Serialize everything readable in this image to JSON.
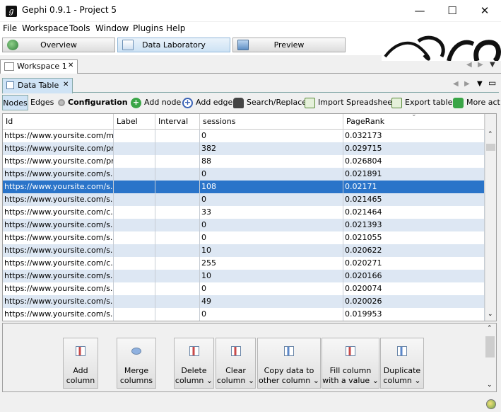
{
  "window": {
    "title": "Gephi 0.9.1 - Project 5",
    "minimize": "—",
    "maximize": "☐",
    "close": "✕"
  },
  "menu": [
    "File",
    "Workspace",
    "Tools",
    "Window",
    "Plugins",
    "Help"
  ],
  "modes": [
    {
      "label": "Overview",
      "active": false
    },
    {
      "label": "Data Laboratory",
      "active": true
    },
    {
      "label": "Preview",
      "active": false
    }
  ],
  "workspace_tab": {
    "label": "Workspace 1",
    "close": "✕"
  },
  "data_table_tab": {
    "label": "Data Table",
    "close": "✕"
  },
  "toolbar": {
    "nodes": "Nodes",
    "edges": "Edges",
    "configuration": "Configuration",
    "add_node": "Add node",
    "add_edge": "Add edge",
    "search_replace": "Search/Replace",
    "import_spreadsheet": "Import Spreadsheet",
    "export_table": "Export table",
    "more_actions": "More act"
  },
  "table": {
    "columns": [
      "Id",
      "Label",
      "Interval",
      "sessions",
      "PageRank"
    ],
    "selected_row": 4,
    "rows": [
      [
        "https://www.yoursite.com/m...",
        "",
        "",
        "0",
        "0.032173"
      ],
      [
        "https://www.yoursite.com/pr...",
        "",
        "",
        "382",
        "0.029715"
      ],
      [
        "https://www.yoursite.com/pr...",
        "",
        "",
        "88",
        "0.026804"
      ],
      [
        "https://www.yoursite.com/s...",
        "",
        "",
        "0",
        "0.021891"
      ],
      [
        "https://www.yoursite.com/s...",
        "",
        "",
        "108",
        "0.02171"
      ],
      [
        "https://www.yoursite.com/s...",
        "",
        "",
        "0",
        "0.021465"
      ],
      [
        "https://www.yoursite.com/c...",
        "",
        "",
        "33",
        "0.021464"
      ],
      [
        "https://www.yoursite.com/s...",
        "",
        "",
        "0",
        "0.021393"
      ],
      [
        "https://www.yoursite.com/s...",
        "",
        "",
        "0",
        "0.021055"
      ],
      [
        "https://www.yoursite.com/s...",
        "",
        "",
        "10",
        "0.020622"
      ],
      [
        "https://www.yoursite.com/c...",
        "",
        "",
        "255",
        "0.020271"
      ],
      [
        "https://www.yoursite.com/s...",
        "",
        "",
        "10",
        "0.020166"
      ],
      [
        "https://www.yoursite.com/s...",
        "",
        "",
        "0",
        "0.020074"
      ],
      [
        "https://www.yoursite.com/s...",
        "",
        "",
        "49",
        "0.020026"
      ],
      [
        "https://www.yoursite.com/s...",
        "",
        "",
        "0",
        "0.019953"
      ]
    ]
  },
  "actions": [
    {
      "line1": "Add",
      "line2": "column"
    },
    {
      "line1": "Merge",
      "line2": "columns"
    },
    {
      "line1": "Delete",
      "line2": "column ⌄"
    },
    {
      "line1": "Clear",
      "line2": "column ⌄"
    },
    {
      "line1": "Copy data to",
      "line2": "other column ⌄"
    },
    {
      "line1": "Fill column",
      "line2": "with a value ⌄"
    },
    {
      "line1": "Duplicate",
      "line2": "column ⌄"
    }
  ],
  "colors": {
    "selection": "#2a74c9",
    "alt_row": "#dde7f3",
    "active_mode": "#cde2f4"
  }
}
